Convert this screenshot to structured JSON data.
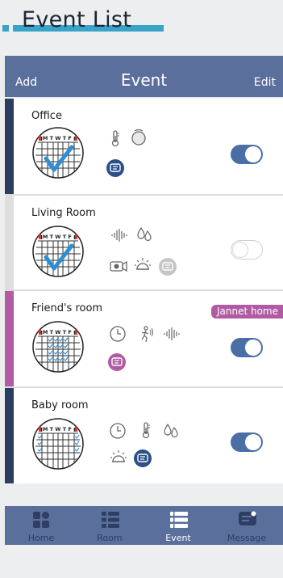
{
  "page_heading": "Event List",
  "header": {
    "add_label": "Add",
    "title": "Event",
    "edit_label": "Edit"
  },
  "events": [
    {
      "name": "Office",
      "accent": "#2c3e60",
      "enabled": true,
      "icons": [
        "thermometer-icon",
        "smoke-detector-icon",
        "message-icon"
      ]
    },
    {
      "name": "Living Room",
      "accent": "#dedede",
      "enabled": false,
      "icons": [
        "sound-icon",
        "water-leak-icon",
        "camera-icon",
        "lamp-icon",
        "message-icon"
      ]
    },
    {
      "name": "Friend's room",
      "accent": "#b05ba3",
      "enabled": true,
      "tag": "Jannet home",
      "icons": [
        "clock-icon",
        "motion-icon",
        "sound-icon",
        "message-icon"
      ]
    },
    {
      "name": "Baby room",
      "accent": "#2c3e60",
      "enabled": true,
      "icons": [
        "clock-icon",
        "thermometer-icon",
        "water-leak-icon",
        "lamp-icon",
        "message-icon"
      ]
    }
  ],
  "nav": [
    {
      "label": "Home",
      "active": false
    },
    {
      "label": "Room",
      "active": false
    },
    {
      "label": "Event",
      "active": true
    },
    {
      "label": "Message",
      "active": false
    }
  ],
  "calendar_days": [
    "S",
    "M",
    "T",
    "W",
    "T",
    "F",
    "S"
  ],
  "colors": {
    "header": "#5b6f9c",
    "toggle_on": "#4a6fa5",
    "accent_blue": "#2d8fd1",
    "tag": "#b05ba3",
    "heading_bar": "#3aa3c8"
  }
}
